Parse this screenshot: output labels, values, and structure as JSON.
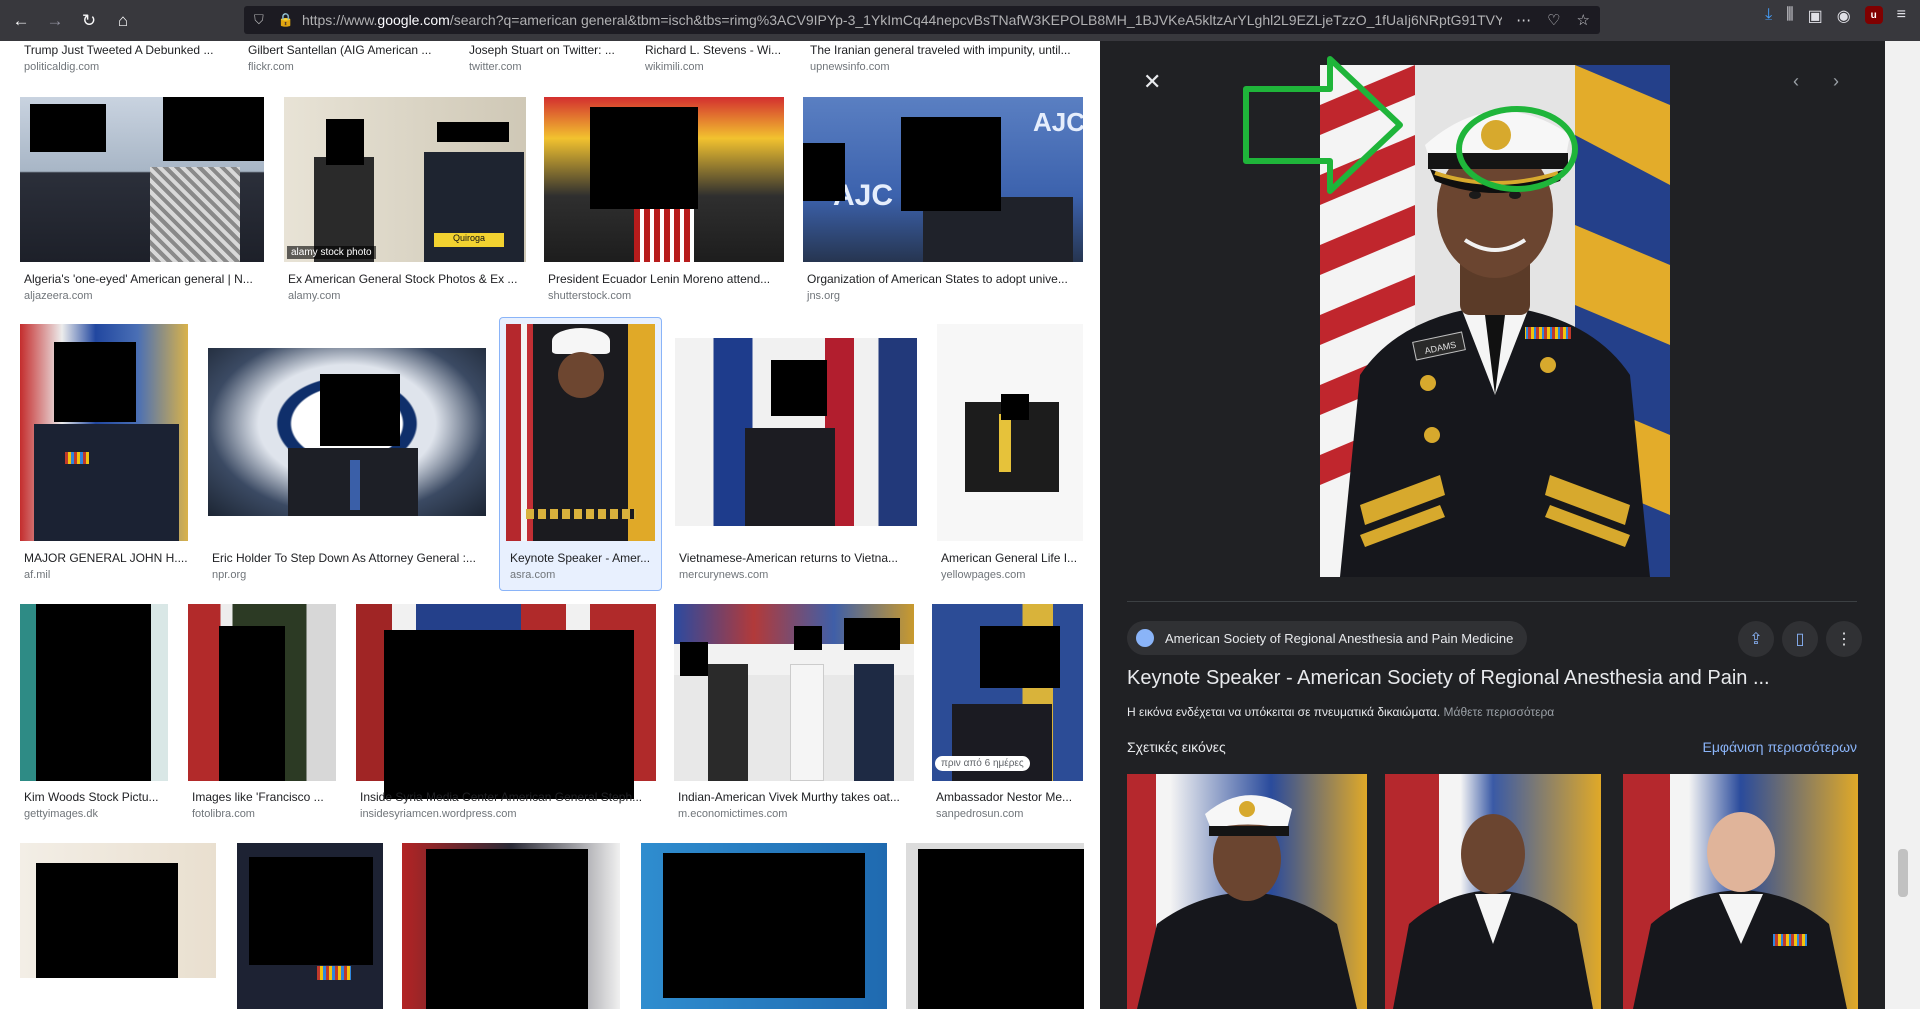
{
  "browser": {
    "url_prefix": "https://www.",
    "url_domain": "google.com",
    "url_rest": "/search?q=american general&tbm=isch&tbs=rimg%3ACV9IPYp-3_1YkImCq44nepcvBsTNafW3KEPOLB8MH_1BJVKeA5kltzArYLghl2L9EZLjeTzzO_1fUaIj6NRptG91TVYG",
    "more_icon": "⋯",
    "download_badge": "1",
    "ublock_label": "u"
  },
  "rows": [
    {
      "tiles": [
        {
          "caption": "Trump Just Tweeted A Debunked ...",
          "domain": "politicaldig.com"
        },
        {
          "caption": "Gilbert Santellan (AIG American ...",
          "domain": "flickr.com"
        },
        {
          "caption": "Joseph Stuart on Twitter: ...",
          "domain": "twitter.com"
        },
        {
          "caption": "Richard L. Stevens - Wi...",
          "domain": "wikimili.com"
        },
        {
          "caption": "The Iranian general traveled with impunity, until...",
          "domain": "upnewsinfo.com"
        }
      ]
    },
    {
      "tiles": [
        {
          "caption": "Algeria's 'one-eyed' American general | N...",
          "domain": "aljazeera.com"
        },
        {
          "caption": "Ex American General Stock Photos & Ex ...",
          "domain": "alamy.com",
          "overlay": "alamy stock photo",
          "inner_text": "Quiroga"
        },
        {
          "caption": "President Ecuador Lenin Moreno attend...",
          "domain": "shutterstock.com"
        },
        {
          "caption": "Organization of American States to adopt unive...",
          "domain": "jns.org",
          "inner_text": "AJC"
        }
      ]
    },
    {
      "tiles": [
        {
          "caption": "MAJOR GENERAL JOHN H....",
          "domain": "af.mil"
        },
        {
          "caption": "Eric Holder To Step Down As Attorney General :...",
          "domain": "npr.org"
        },
        {
          "caption": "Keynote Speaker - Amer...",
          "domain": "asra.com"
        },
        {
          "caption": "Vietnamese-American returns to Vietna...",
          "domain": "mercurynews.com"
        },
        {
          "caption": "American General Life I...",
          "domain": "yellowpages.com"
        }
      ]
    },
    {
      "tiles": [
        {
          "caption": "Kim Woods Stock Pictu...",
          "domain": "gettyimages.dk"
        },
        {
          "caption": "Images like 'Francisco ...",
          "domain": "fotolibra.com"
        },
        {
          "caption": "Inside Syria Media Center American General Steph...",
          "domain": "insidesyriamcen.wordpress.com"
        },
        {
          "caption": "Indian-American Vivek Murthy takes oat...",
          "domain": "m.economictimes.com"
        },
        {
          "caption": "Ambassador Nestor Me...",
          "domain": "sanpedrosun.com",
          "badge": "πριν από 6 ημέρες"
        }
      ]
    }
  ],
  "panel": {
    "source": "American Society of Regional Anesthesia and Pain Medicine",
    "title": "Keynote Speaker - American Society of Regional Anesthesia and Pain ...",
    "copyright_text": "Η εικόνα ενδέχεται να υπόκειται σε πνευματικά δικαιώματα.",
    "copyright_link": "Μάθετε περισσότερα",
    "related_label": "Σχετικές εικόνες",
    "see_more": "Εμφάνιση περισσότερων",
    "nametag": "ADAMS",
    "share_icon": "share-icon",
    "bookmark_icon": "bookmark-icon",
    "more_icon": "more-vert-icon"
  },
  "colors": {
    "panel_bg": "#202124",
    "link_blue": "#8ab4f8",
    "annotation_green": "#1fb53a",
    "selected_border": "#8ab4f8"
  }
}
